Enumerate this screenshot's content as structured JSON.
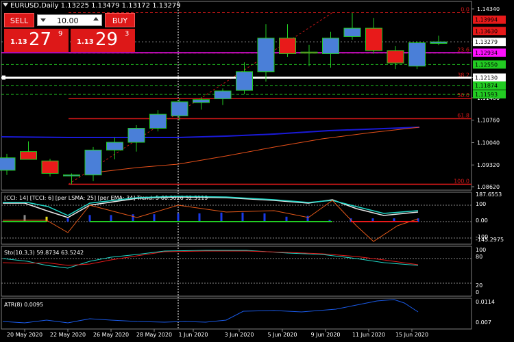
{
  "symbol_line": "EURUSD,Daily  1.13225 1.13479 1.13172 1.13279",
  "trade_panel": {
    "sell_label": "SELL",
    "buy_label": "BUY",
    "lot_value": "10.00",
    "bid_small": "1.13",
    "bid_big": "27",
    "bid_sup": "9",
    "ask_small": "1.13",
    "ask_big": "29",
    "ask_sup": "3"
  },
  "colors": {
    "bg": "#000000",
    "bull_candle": "#4a7fd8",
    "bear_candle": "#e81a1a",
    "wick": "#22cc22",
    "fib": "#d01818",
    "magenta": "#ff10ff",
    "ma_blue": "#1a1ad8",
    "ma_orange": "#e8501a"
  },
  "price_axis": {
    "ticks": [
      "1.14340",
      "1.12130",
      "1.11480",
      "1.10760",
      "1.10040",
      "1.09320",
      "1.08620"
    ],
    "flags": [
      {
        "label": "1.13994",
        "color": "#e81a1a"
      },
      {
        "label": "1.13630",
        "color": "#e81a1a"
      },
      {
        "label": "1.13279",
        "color": "#ffffff"
      },
      {
        "label": "1.12934",
        "color": "#ff10ff"
      },
      {
        "label": "1.12550",
        "color": "#22cc22"
      },
      {
        "label": "1.12130",
        "color": "#ffffff"
      },
      {
        "label": "1.11874",
        "color": "#22cc22"
      },
      {
        "label": "1.11593",
        "color": "#22cc22"
      }
    ]
  },
  "fib_levels": [
    "0.0",
    "23.6",
    "38.2",
    "50.0",
    "61.8",
    "100.0"
  ],
  "cci": {
    "label": "[CCI: 14] [TCCI: 6] [per LSMA: 25] [per EMA: 34] Trend: 5  66.3026 32.3119",
    "ticks": [
      "187.6553",
      "100",
      "0.00",
      "-100",
      "-145.2975"
    ]
  },
  "sto": {
    "label": "Sto(10,3,3) 59.8734 63.5242",
    "ticks": [
      "100",
      "80",
      "20",
      "0"
    ]
  },
  "atr": {
    "label": "ATR(8) 0.0095",
    "ticks": [
      "0.0114",
      "0.007"
    ]
  },
  "time_axis": [
    "20 May 2020",
    "22 May 2020",
    "26 May 2020",
    "28 May 2020",
    "1 Jun 2020",
    "3 Jun 2020",
    "5 Jun 2020",
    "9 Jun 2020",
    "11 Jun 2020",
    "15 Jun 2020"
  ],
  "candles": [
    {
      "date": "19 May 2020",
      "o": 1.0915,
      "h": 1.0968,
      "l": 1.09,
      "c": 1.0955
    },
    {
      "date": "20 May 2020",
      "o": 1.0975,
      "h": 1.1008,
      "l": 1.095,
      "c": 1.095
    },
    {
      "date": "21 May 2020",
      "o": 1.0945,
      "h": 1.0952,
      "l": 1.0895,
      "c": 1.0905
    },
    {
      "date": "22 May 2020",
      "o": 1.0898,
      "h": 1.0905,
      "l": 1.087,
      "c": 1.09
    },
    {
      "date": "25 May 2020",
      "o": 1.09,
      "h": 1.099,
      "l": 1.088,
      "c": 1.098
    },
    {
      "date": "26 May 2020",
      "o": 1.098,
      "h": 1.102,
      "l": 1.095,
      "c": 1.1005
    },
    {
      "date": "27 May 2020",
      "o": 1.1005,
      "h": 1.106,
      "l": 1.0975,
      "c": 1.105
    },
    {
      "date": "28 May 2020",
      "o": 1.105,
      "h": 1.1108,
      "l": 1.104,
      "c": 1.1095
    },
    {
      "date": "29 May 2020",
      "o": 1.109,
      "h": 1.1147,
      "l": 1.1075,
      "c": 1.1135
    },
    {
      "date": "1 Jun 2020",
      "o": 1.1133,
      "h": 1.115,
      "l": 1.111,
      "c": 1.1142
    },
    {
      "date": "2 Jun 2020",
      "o": 1.1145,
      "h": 1.1178,
      "l": 1.1125,
      "c": 1.117
    },
    {
      "date": "3 Jun 2020",
      "o": 1.1172,
      "h": 1.1262,
      "l": 1.116,
      "c": 1.1232
    },
    {
      "date": "4 Jun 2020",
      "o": 1.1232,
      "h": 1.1385,
      "l": 1.12,
      "c": 1.134
    },
    {
      "date": "5 Jun 2020",
      "o": 1.134,
      "h": 1.1385,
      "l": 1.128,
      "c": 1.129
    },
    {
      "date": "8 Jun 2020",
      "o": 1.1295,
      "h": 1.1318,
      "l": 1.125,
      "c": 1.1292
    },
    {
      "date": "9 Jun 2020",
      "o": 1.129,
      "h": 1.136,
      "l": 1.1245,
      "c": 1.134
    },
    {
      "date": "10 Jun 2020",
      "o": 1.1345,
      "h": 1.1421,
      "l": 1.1335,
      "c": 1.1372
    },
    {
      "date": "11 Jun 2020",
      "o": 1.1372,
      "h": 1.1405,
      "l": 1.129,
      "c": 1.13
    },
    {
      "date": "12 Jun 2020",
      "o": 1.13,
      "h": 1.1315,
      "l": 1.124,
      "c": 1.126
    },
    {
      "date": "15 Jun 2020",
      "o": 1.125,
      "h": 1.133,
      "l": 1.124,
      "c": 1.1325
    },
    {
      "date": "16 Jun 2020",
      "o": 1.1323,
      "h": 1.1348,
      "l": 1.1317,
      "c": 1.1328
    }
  ]
}
